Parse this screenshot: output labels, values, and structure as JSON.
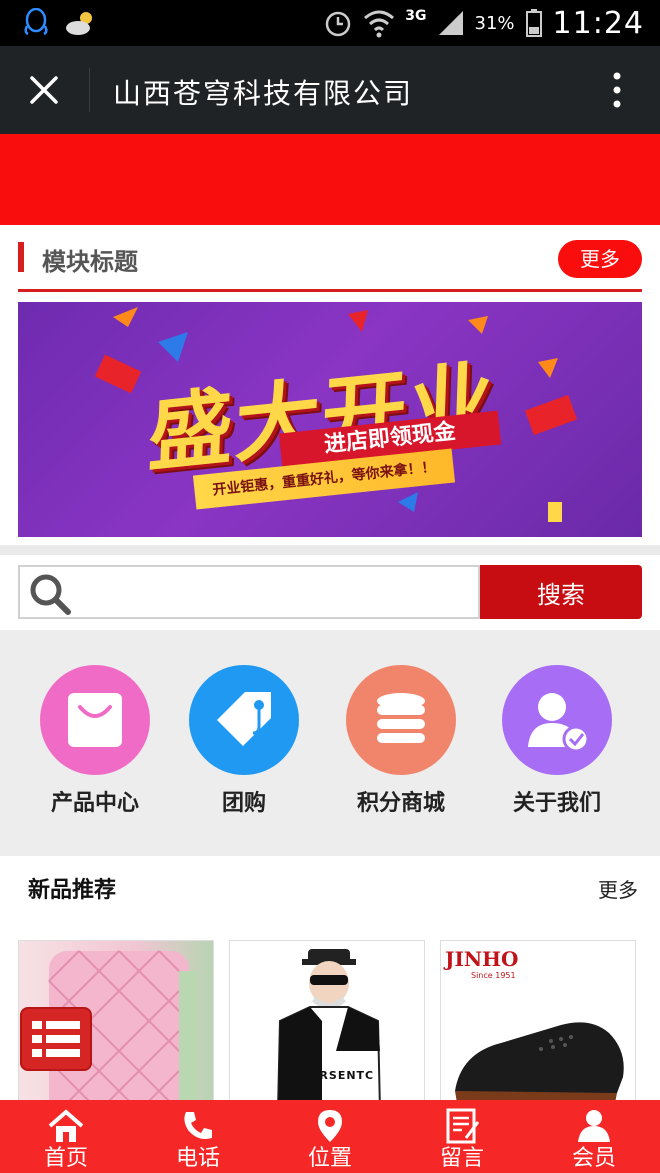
{
  "status_bar": {
    "network": "3G",
    "battery": "31%",
    "time": "11:24"
  },
  "app_bar": {
    "title": "山西苍穹科技有限公司"
  },
  "module": {
    "title": "模块标题",
    "more_label": "更多"
  },
  "promo": {
    "headline": "盛大开业",
    "subline": "进店即领现金",
    "slogan": "开业钜惠，重重好礼，等你来拿！！"
  },
  "search": {
    "placeholder": "",
    "value": "",
    "button_label": "搜索"
  },
  "nav": [
    {
      "label": "产品中心",
      "icon": "shopping-bag-icon",
      "color": "#f06bc6"
    },
    {
      "label": "团购",
      "icon": "tag-icon",
      "color": "#1f99f2"
    },
    {
      "label": "积分商城",
      "icon": "coin-stack-icon",
      "color": "#f0856b"
    },
    {
      "label": "关于我们",
      "icon": "user-check-icon",
      "color": "#a76ef5"
    }
  ],
  "new_products": {
    "title": "新品推荐",
    "more_label": "更多",
    "items": [
      {
        "image": "pink-luggage"
      },
      {
        "image": "tshirt-model",
        "text": "YARSENTC"
      },
      {
        "image": "black-shoe",
        "brand": "JINHO",
        "brand_sub": "Since 1951"
      }
    ]
  },
  "bottom_nav": [
    {
      "label": "首页",
      "icon": "home-icon"
    },
    {
      "label": "电话",
      "icon": "phone-icon"
    },
    {
      "label": "位置",
      "icon": "location-icon"
    },
    {
      "label": "留言",
      "icon": "message-icon"
    },
    {
      "label": "会员",
      "icon": "member-icon"
    }
  ],
  "colors": {
    "brand_red": "#fa0d0d",
    "dark_red": "#c70d12",
    "appbar": "#1f2326"
  }
}
